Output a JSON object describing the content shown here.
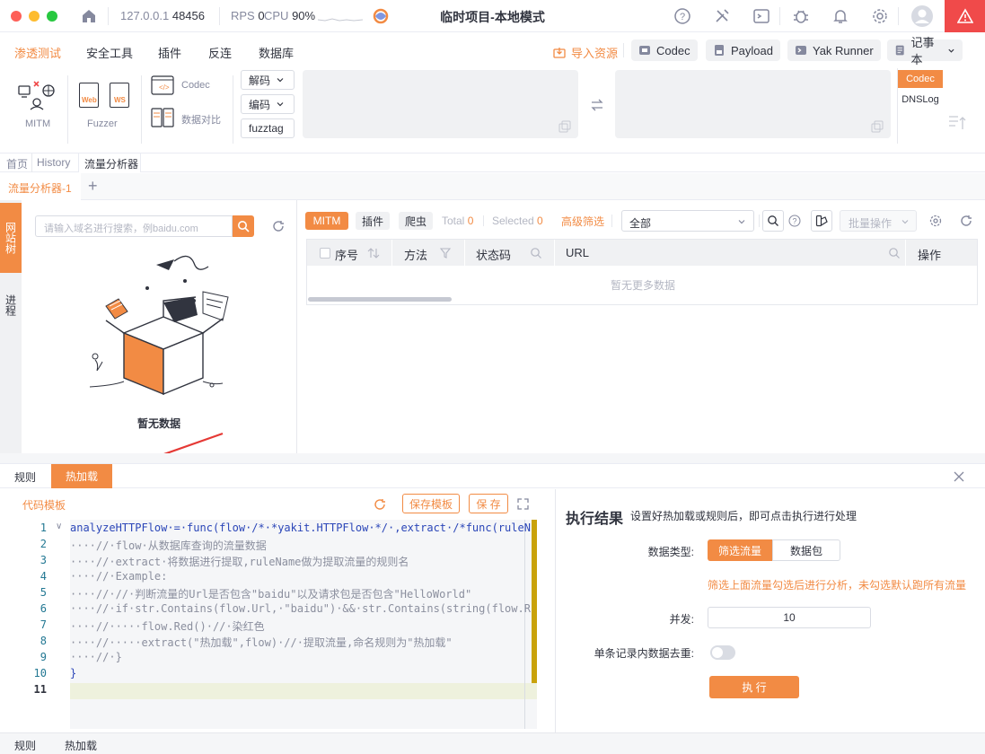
{
  "titlebar": {
    "host": "127.0.0.1",
    "port": "48456",
    "rps_label": "RPS",
    "rps_value": "0",
    "cpu_label": "CPU",
    "cpu_value": "90%",
    "title": "临时项目-本地模式"
  },
  "menu": {
    "items": [
      "渗透测试",
      "安全工具",
      "插件",
      "反连",
      "数据库"
    ],
    "import_label": "导入资源",
    "codec_label": "Codec",
    "payload_label": "Payload",
    "runner_label": "Yak Runner",
    "notebook_label": "记事本"
  },
  "tools": {
    "mitm_label": "MITM",
    "fuzzer_label": "Fuzzer",
    "web_label": "Web",
    "ws_label": "WS",
    "codec_label": "Codec",
    "compare_label": "数据对比",
    "decode_label": "解码",
    "encode_label": "编码",
    "fuzztag_label": "fuzztag",
    "codec_tag": "Codec",
    "dnslog_tag": "DNSLog"
  },
  "tabs": {
    "items": [
      "首页",
      "History",
      "流量分析器"
    ],
    "sub_tab": "流量分析器-1"
  },
  "sidebar": {
    "tab1": "网站树",
    "tab2": "进程"
  },
  "left_panel": {
    "search_placeholder": "请输入域名进行搜索，例baidu.com",
    "empty_text": "暂无数据"
  },
  "filter": {
    "mitm": "MITM",
    "plugin": "插件",
    "crawler": "爬虫",
    "total_label": "Total",
    "total_value": "0",
    "selected_label": "Selected",
    "selected_value": "0",
    "advanced": "高级筛选",
    "select_value": "全部",
    "batch": "批量操作"
  },
  "table": {
    "columns": [
      "序号",
      "方法",
      "状态码",
      "URL",
      "操作"
    ],
    "empty": "暂无更多数据"
  },
  "bottom": {
    "tab_rules": "规则",
    "tab_hotload": "热加载",
    "template_label": "代码模板",
    "save_template": "保存模板",
    "save": "保 存",
    "code_lines": [
      "analyzeHTTPFlow·=·func(flow·/*·*yakit.HTTPFlow·*/·,extract·/*func(ruleN",
      "····//·flow·从数据库查询的流量数据",
      "····//·extract·将数据进行提取,ruleName做为提取流量的规则名",
      "····//·Example:",
      "····//·//·判断流量的Url是否包含\"baidu\"以及请求包是否包含\"HelloWorld\"",
      "····//·if·str.Contains(flow.Url,·\"baidu\")·&&·str.Contains(string(flow.R",
      "····//·····flow.Red()·//·染红色",
      "····//·····extract(\"热加载\",flow)·//·提取流量,命名规则为\"热加载\"",
      "····//·}",
      "}",
      ""
    ],
    "result_title": "执行结果",
    "result_hint": "设置好热加载或规则后，即可点击执行进行处理",
    "data_type_label": "数据类型:",
    "filter_traffic": "筛选流量",
    "packet": "数据包",
    "filter_hint": "筛选上面流量勾选后进行分析，未勾选默认跑所有流量",
    "concurrency_label": "并发:",
    "concurrency_value": "10",
    "dedup_label": "单条记录内数据去重:",
    "execute": "执 行"
  },
  "status_bar": {
    "rules": "规则",
    "hotload": "热加载"
  },
  "colors": {
    "accent": "#f28b44",
    "danger": "#f04a4a"
  }
}
